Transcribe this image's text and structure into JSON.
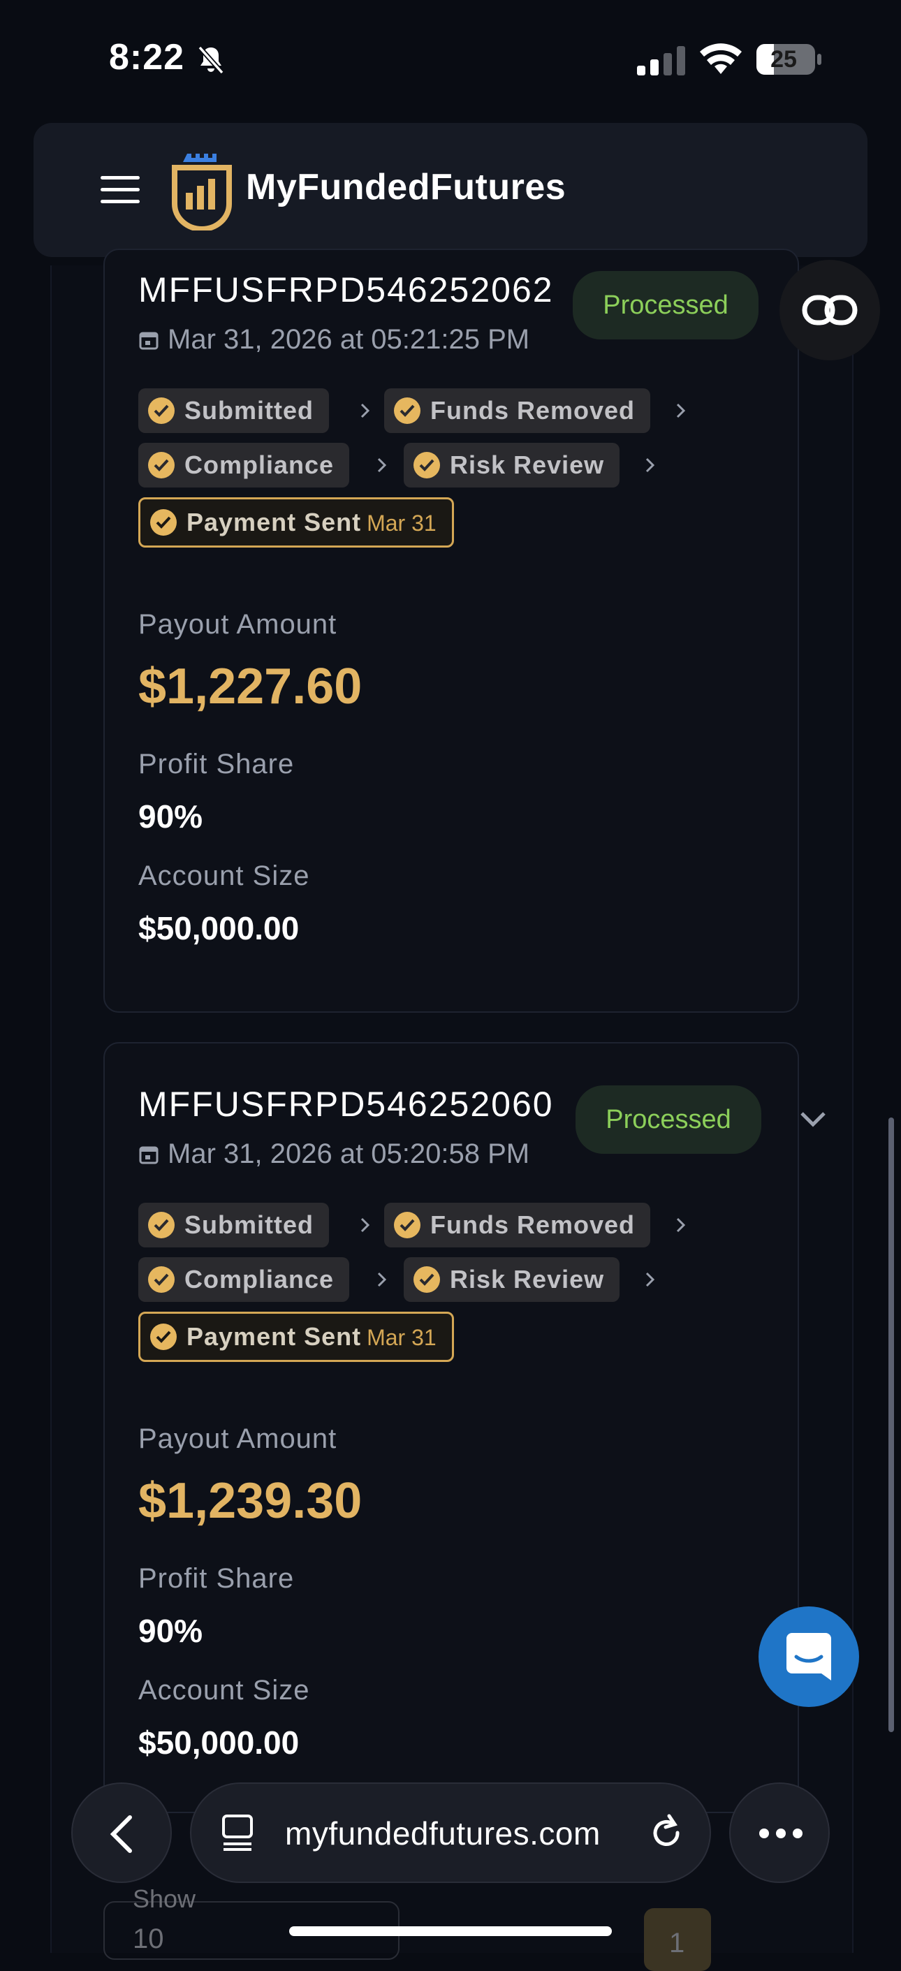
{
  "status_bar": {
    "time": "8:22",
    "battery": "25"
  },
  "header": {
    "brand": "MyFundedFutures"
  },
  "steps_labels": {
    "submitted": "Submitted",
    "funds_removed": "Funds Removed",
    "compliance": "Compliance",
    "risk_review": "Risk Review",
    "payment_sent": "Payment Sent"
  },
  "field_labels": {
    "payout_amount": "Payout Amount",
    "profit_share": "Profit Share",
    "account_size": "Account Size"
  },
  "payouts": [
    {
      "id": "MFFUSFRPD546252062",
      "status": "Processed",
      "date": "Mar 31, 2026 at 05:21:25 PM",
      "payment_sent_date": "Mar 31",
      "payout_amount": "$1,227.60",
      "profit_share": "90%",
      "account_size": "$50,000.00"
    },
    {
      "id": "MFFUSFRPD546252060",
      "status": "Processed",
      "date": "Mar 31, 2026 at 05:20:58 PM",
      "payment_sent_date": "Mar 31",
      "payout_amount": "$1,239.30",
      "profit_share": "90%",
      "account_size": "$50,000.00"
    }
  ],
  "pagination": {
    "show_label": "Show",
    "per_page": "10",
    "current_page": "1"
  },
  "browser": {
    "url": "myfundedfutures.com"
  },
  "colors": {
    "accent_gold": "#e2b463",
    "processed_green": "#8ccf5a",
    "chat_blue": "#1f75c7"
  }
}
